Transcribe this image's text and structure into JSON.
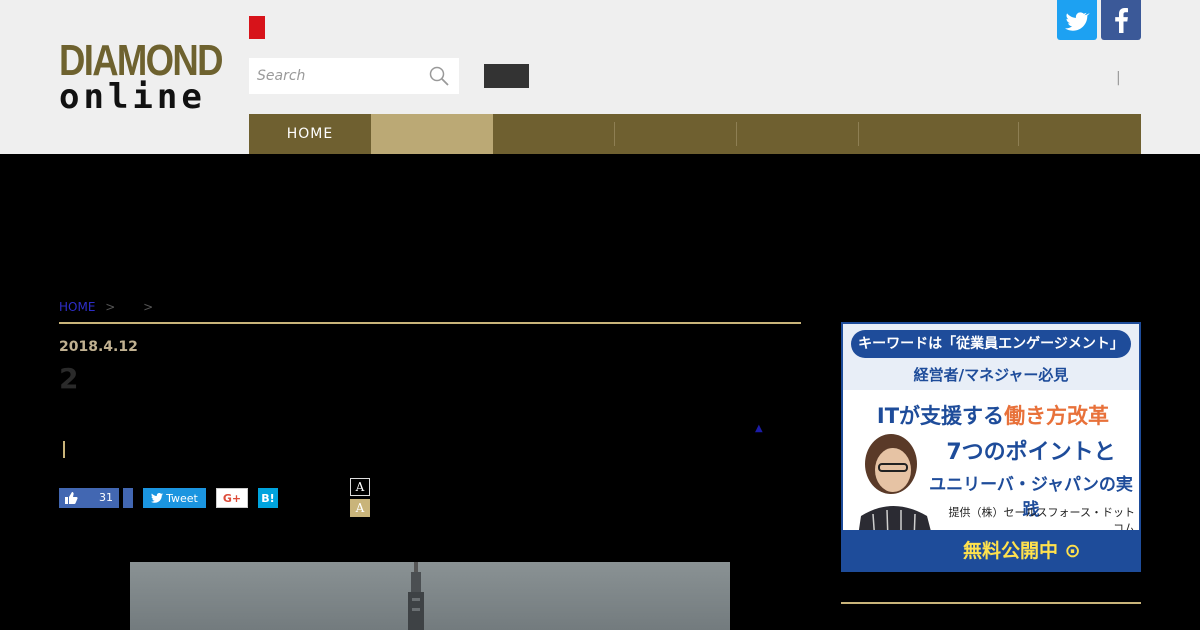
{
  "header": {
    "logo_line1": "DIAMOND",
    "logo_line2": "online",
    "search_placeholder": "Search",
    "pipe": "|"
  },
  "social_header": {
    "twitter_icon": "twitter-icon",
    "facebook_icon": "facebook-icon"
  },
  "nav": {
    "items": [
      {
        "label": "HOME",
        "active": false
      },
      {
        "label": "",
        "active": true
      },
      {
        "label": "",
        "active": false
      },
      {
        "label": "",
        "active": false
      },
      {
        "label": "",
        "active": false
      },
      {
        "label": "",
        "active": false
      },
      {
        "label": "",
        "active": false
      }
    ]
  },
  "breadcrumb": {
    "home": "HOME",
    "sep1": ">",
    "sep2": ">"
  },
  "article": {
    "date": "2018.4.12",
    "title": "2",
    "triangle": "▲",
    "bar": "|"
  },
  "share": {
    "like_count": "31",
    "tweet_label": "Tweet",
    "gplus_label": "G+",
    "hatena_label": "B!",
    "font_size_a1": "A",
    "font_size_a2": "A"
  },
  "ad": {
    "pill": "キーワードは「従業員エンゲージメント」",
    "sub": "経営者/マネジャー必見",
    "line1_a": "ITが支援する",
    "line1_b": "働き方改革",
    "line2": "7つのポイントと",
    "line3": "ユニリーバ・ジャパンの実践",
    "provider": "提供（株）セールスフォース・ドットコム",
    "cta": "無料公開中 ⊙"
  },
  "colors": {
    "nav_bg": "#6f6030",
    "nav_active": "#bba975",
    "accent_gold": "#c9b47a",
    "brand_red": "#d7131a"
  }
}
